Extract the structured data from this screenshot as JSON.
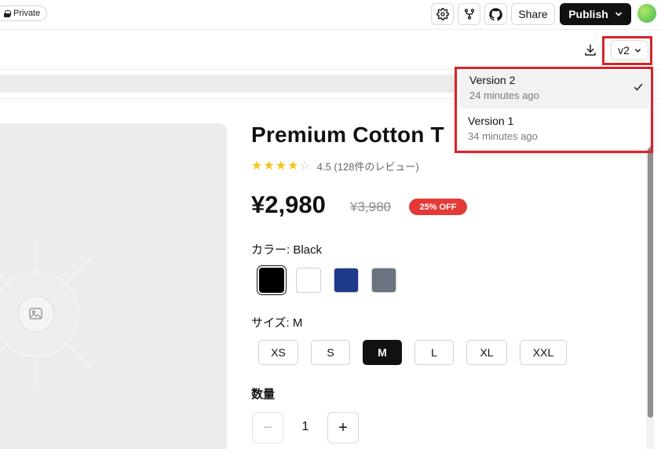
{
  "topbar": {
    "private_label": "Private",
    "share_label": "Share",
    "publish_label": "Publish",
    "icons": [
      "gear-icon",
      "fork-icon",
      "github-icon"
    ]
  },
  "toolbar": {
    "version_label": "v2"
  },
  "versions_menu": {
    "items": [
      {
        "name": "Version 2",
        "time": "24 minutes ago",
        "selected": true
      },
      {
        "name": "Version 1",
        "time": "34 minutes ago",
        "selected": false
      }
    ]
  },
  "product": {
    "title": "Premium Cotton T",
    "rating_value": 4.5,
    "rating_stars_filled": 4,
    "rating_stars_total": 5,
    "rating_text": "4.5 (128件のレビュー)",
    "price": "¥2,980",
    "old_price": "¥3,980",
    "discount": "25% OFF",
    "color_label": "カラー: Black",
    "colors": [
      {
        "name": "Black",
        "hex": "#000000",
        "selected": true
      },
      {
        "name": "White",
        "hex": "#ffffff",
        "selected": false
      },
      {
        "name": "Navy",
        "hex": "#1e3a8a",
        "selected": false
      },
      {
        "name": "Gray",
        "hex": "#6b7280",
        "selected": false
      }
    ],
    "size_label": "サイズ: M",
    "sizes": [
      "XS",
      "S",
      "M",
      "L",
      "XL",
      "XXL"
    ],
    "selected_size": "M",
    "quantity_label": "数量",
    "quantity": "1",
    "qty_minus": "−",
    "qty_plus": "+"
  },
  "colors": {
    "accent_highlight": "#d8232a",
    "discount_badge": "#e53935",
    "star": "#f5c518"
  }
}
